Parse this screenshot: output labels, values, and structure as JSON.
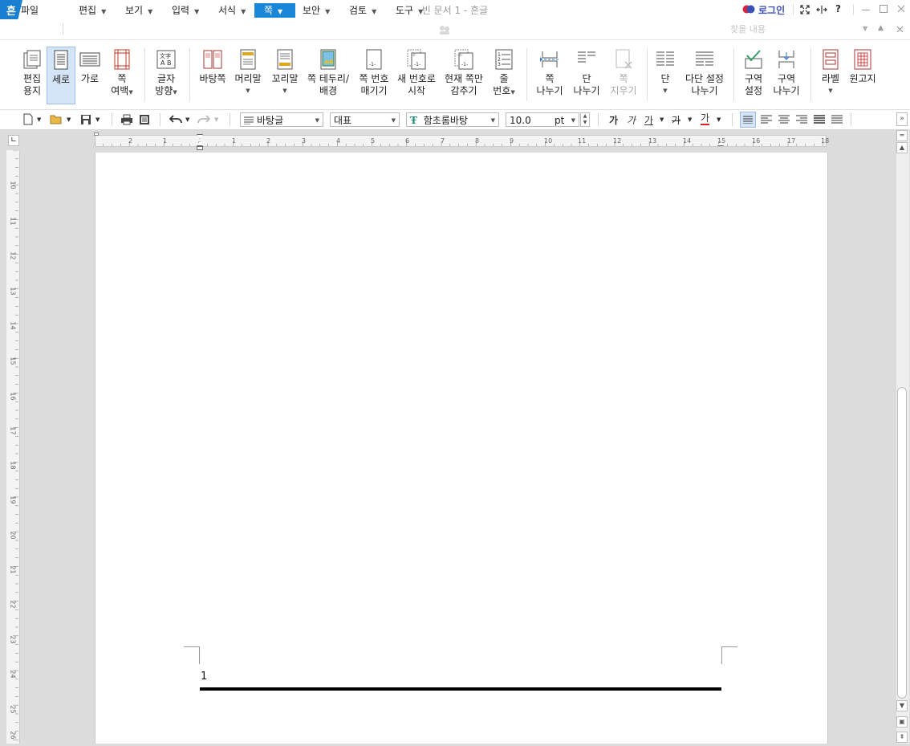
{
  "window": {
    "title": "빈 문서 1 - 흔글",
    "app_logo": "흔",
    "login_label": "로그인",
    "icons": [
      "login-icon",
      "fullscreen-icon",
      "width-fit-icon",
      "help-icon",
      "minimize-icon",
      "maximize-icon",
      "close-icon"
    ],
    "help_text": "?"
  },
  "menu": {
    "file": "파일",
    "items": [
      {
        "label": "편집"
      },
      {
        "label": "보기"
      },
      {
        "label": "입력"
      },
      {
        "label": "서식"
      },
      {
        "label": "쪽",
        "active": true
      },
      {
        "label": "보안"
      },
      {
        "label": "검토"
      },
      {
        "label": "도구"
      }
    ],
    "search_placeholder": "찾을 내용"
  },
  "ribbon": {
    "edit_paper": [
      "편집",
      "용지"
    ],
    "portrait": "세로",
    "landscape": "가로",
    "margin": [
      "쪽",
      "여백"
    ],
    "text_direction": [
      "글자",
      "방향"
    ],
    "master_page": "바탕쪽",
    "header": "머리말",
    "footer": "꼬리말",
    "page_border": [
      "쪽 테두리/",
      "배경"
    ],
    "page_numbering": [
      "쪽 번호",
      "매기기"
    ],
    "new_number": [
      "새 번호로",
      "시작"
    ],
    "hide_current": [
      "현재 쪽만",
      "감추기"
    ],
    "line_number": [
      "줄",
      "번호"
    ],
    "page_break": [
      "쪽",
      "나누기"
    ],
    "column_break": [
      "단",
      "나누기"
    ],
    "page_delete": [
      "쪽",
      "지우기"
    ],
    "columns": "단",
    "multi_column": [
      "다단 설정",
      "나누기"
    ],
    "section_setting": [
      "구역",
      "설정"
    ],
    "section_break": [
      "구역",
      "나누기"
    ],
    "label": "라벨",
    "manuscript": "원고지"
  },
  "format_bar": {
    "style": "바탕글",
    "language": "대표",
    "font": "함초롬바탕",
    "font_size": "10.0",
    "unit": "pt",
    "bold": "가",
    "italic": "가",
    "underline": "가",
    "strike": "가",
    "font_color": "가",
    "font_color_hex": "#e02020"
  },
  "ruler": {
    "h_numbers": [
      "2",
      "1",
      "1",
      "2",
      "3",
      "4",
      "5",
      "6",
      "7",
      "8",
      "9",
      "10",
      "11",
      "12",
      "13",
      "14",
      "15",
      "16",
      "17",
      "18"
    ],
    "v_numbers": [
      "10",
      "11",
      "12",
      "13",
      "14",
      "15",
      "16",
      "17",
      "18",
      "19",
      "20",
      "21",
      "22",
      "23",
      "24",
      "25",
      "26"
    ]
  },
  "document": {
    "page_number": "1"
  },
  "colors": {
    "accent": "#1a86d8",
    "login": "#3b4fb5"
  }
}
